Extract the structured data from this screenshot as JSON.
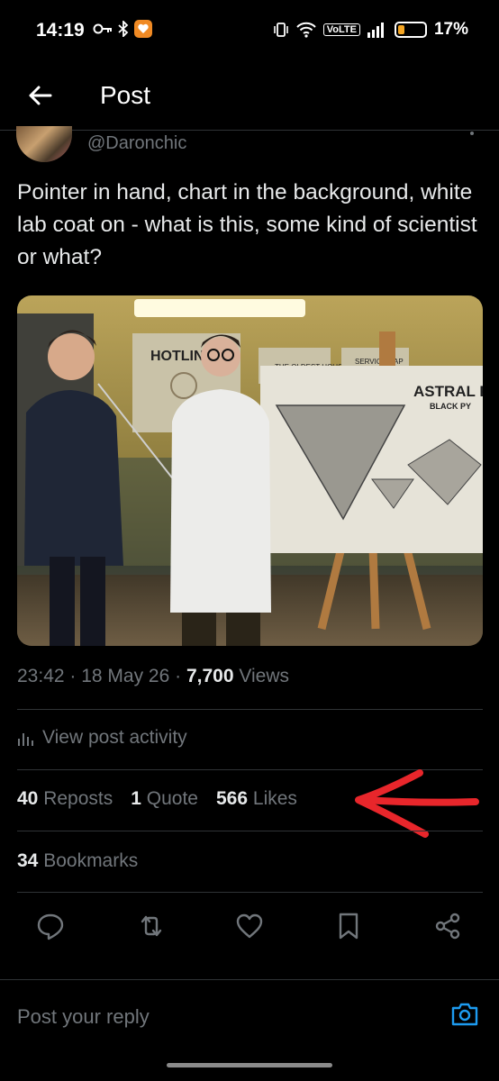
{
  "status_bar": {
    "time": "14:19",
    "network": "VoLTE",
    "battery": "17%",
    "battery_level": 0.17
  },
  "header": {
    "title": "Post",
    "back_icon": "arrow-left-icon"
  },
  "post": {
    "handle": "@Daronchic",
    "text": "Pointer in hand, chart in the background, white lab coat on - what is this, some kind of scientist or what?",
    "image_signs": {
      "hotline": "HOTLINE",
      "oldest_house": "THE OLDEST HOUSE",
      "service": "SERVICE NAP",
      "chart_title": "ASTRAL PL",
      "chart_subtitle": "BLACK PY"
    },
    "time": "23:42",
    "date": "18 May 26",
    "views_count": "7,700",
    "views_label": "Views",
    "activity_label": "View post activity"
  },
  "stats": {
    "reposts_count": "40",
    "reposts_label": "Reposts",
    "quotes_count": "1",
    "quotes_label": "Quote",
    "likes_count": "566",
    "likes_label": "Likes",
    "bookmarks_count": "34",
    "bookmarks_label": "Bookmarks"
  },
  "actions": [
    "reply-icon",
    "repost-icon",
    "like-icon",
    "bookmark-icon",
    "share-icon"
  ],
  "reply": {
    "placeholder": "Post your reply"
  },
  "colors": {
    "background": "#000000",
    "text": "#e7e9ea",
    "muted": "#71767b",
    "accent": "#1d9bf0",
    "annotation": "#e8262b"
  }
}
